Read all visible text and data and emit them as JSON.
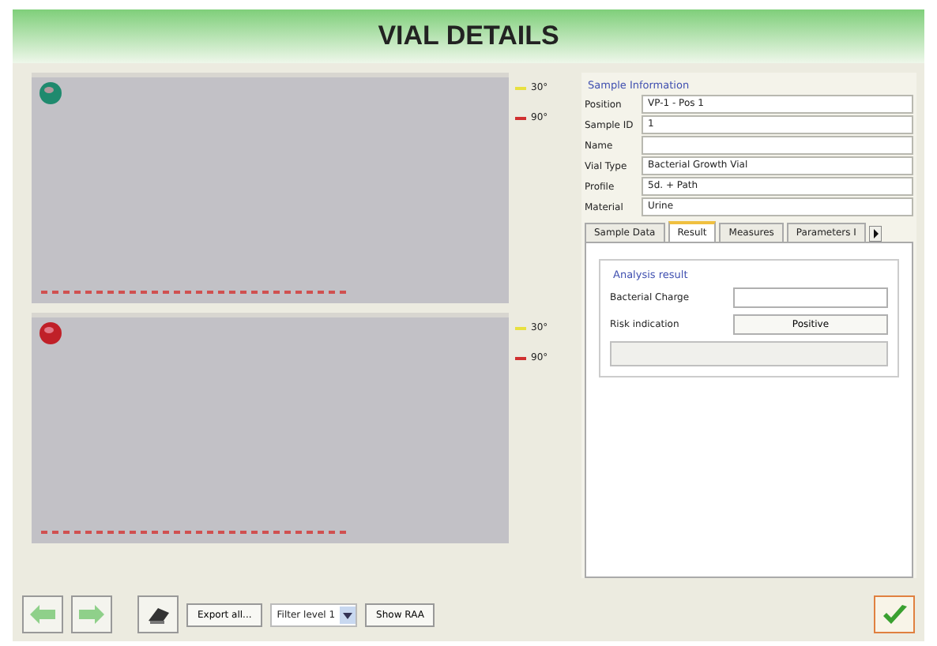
{
  "window": {
    "title": "VIAL DETAILS"
  },
  "plots": [
    {
      "color": "#1f8a6e",
      "legend": [
        {
          "label": "30°",
          "color": "#e8e040"
        },
        {
          "label": "90°",
          "color": "#d03030"
        }
      ]
    },
    {
      "color": "#c02028",
      "legend": [
        {
          "label": "30°",
          "color": "#e8e040"
        },
        {
          "label": "90°",
          "color": "#d03030"
        }
      ]
    }
  ],
  "sample_information": {
    "title": "Sample Information",
    "fields": [
      {
        "label": "Position",
        "value": "VP-1 - Pos 1"
      },
      {
        "label": "Sample ID",
        "value": "1"
      },
      {
        "label": "Name"
      },
      {
        "label": "Vial Type",
        "value": "Bacterial Growth Vial"
      },
      {
        "label": "Profile",
        "value": "5d. + Path"
      },
      {
        "label": "Material",
        "value": "Urine"
      }
    ]
  },
  "tabs": [
    {
      "label": "Sample Data",
      "selected": false
    },
    {
      "label": "Result",
      "selected": true
    },
    {
      "label": "Measures",
      "selected": false
    },
    {
      "label": "Parameters I",
      "selected": false
    }
  ],
  "analysis_result": {
    "title": "Analysis result",
    "rows": [
      {
        "label": "Bacterial Charge",
        "kind": "field"
      },
      {
        "label": "Risk indication",
        "kind": "button",
        "value": "Positive"
      }
    ]
  },
  "toolbar": {
    "export": "Export all...",
    "filter": "Filter level 1",
    "show": "Show RAA"
  }
}
